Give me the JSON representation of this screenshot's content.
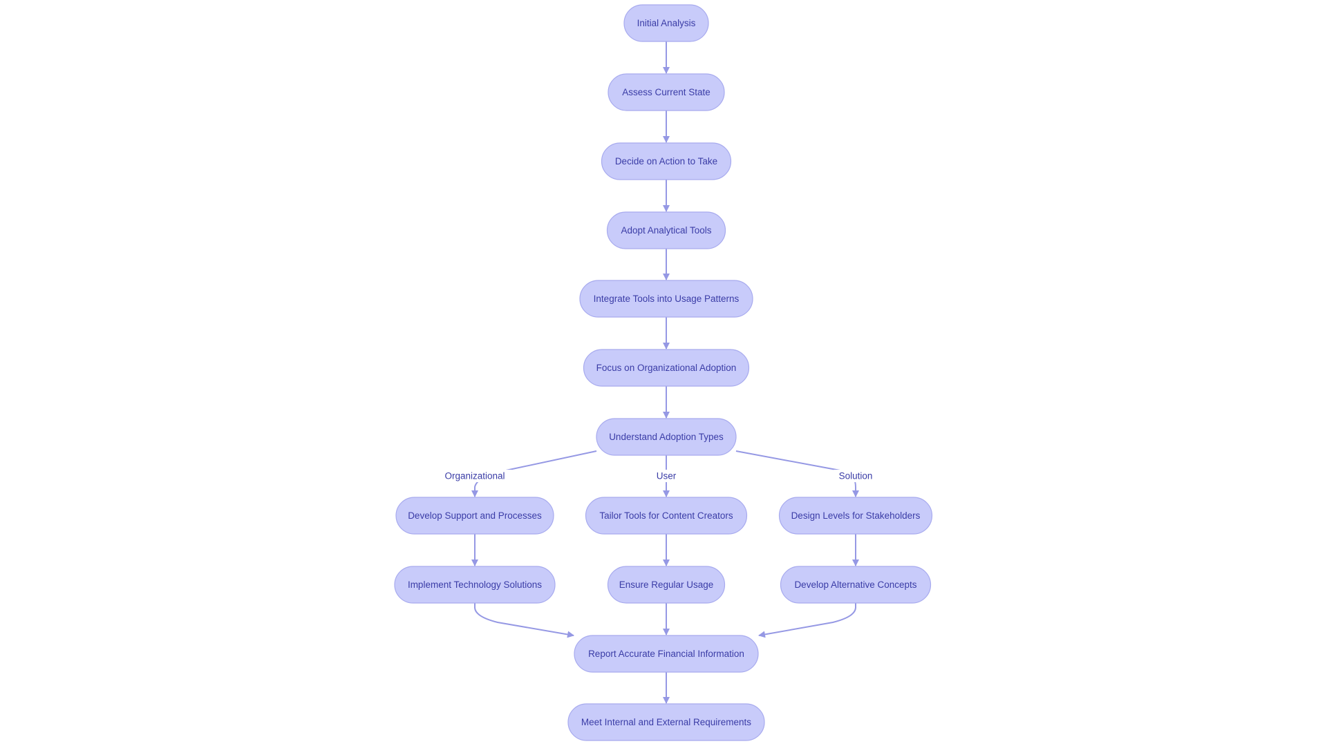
{
  "diagram": {
    "type": "flowchart",
    "direction": "top-down",
    "colors": {
      "node_fill": "#C8CBFA",
      "node_border": "#A7AAEE",
      "text": "#3A3CA6",
      "edge": "#9598E4",
      "background": "#FFFFFF"
    },
    "nodes": [
      {
        "id": "n1",
        "label": "Initial Analysis"
      },
      {
        "id": "n2",
        "label": "Assess Current State"
      },
      {
        "id": "n3",
        "label": "Decide on Action to Take"
      },
      {
        "id": "n4",
        "label": "Adopt Analytical Tools"
      },
      {
        "id": "n5",
        "label": "Integrate Tools into Usage Patterns"
      },
      {
        "id": "n6",
        "label": "Focus on Organizational Adoption"
      },
      {
        "id": "n7",
        "label": "Understand Adoption Types"
      },
      {
        "id": "n8",
        "label": "Develop Support and Processes"
      },
      {
        "id": "n9",
        "label": "Tailor Tools for Content Creators"
      },
      {
        "id": "n10",
        "label": "Design Levels for Stakeholders"
      },
      {
        "id": "n11",
        "label": "Implement Technology Solutions"
      },
      {
        "id": "n12",
        "label": "Ensure Regular Usage"
      },
      {
        "id": "n13",
        "label": "Develop Alternative Concepts"
      },
      {
        "id": "n14",
        "label": "Report Accurate Financial Information"
      },
      {
        "id": "n15",
        "label": "Meet Internal and External Requirements"
      }
    ],
    "edges": [
      {
        "from": "n1",
        "to": "n2",
        "label": ""
      },
      {
        "from": "n2",
        "to": "n3",
        "label": ""
      },
      {
        "from": "n3",
        "to": "n4",
        "label": ""
      },
      {
        "from": "n4",
        "to": "n5",
        "label": ""
      },
      {
        "from": "n5",
        "to": "n6",
        "label": ""
      },
      {
        "from": "n6",
        "to": "n7",
        "label": ""
      },
      {
        "from": "n7",
        "to": "n8",
        "label": "Organizational"
      },
      {
        "from": "n7",
        "to": "n9",
        "label": "User"
      },
      {
        "from": "n7",
        "to": "n10",
        "label": "Solution"
      },
      {
        "from": "n8",
        "to": "n11",
        "label": ""
      },
      {
        "from": "n9",
        "to": "n12",
        "label": ""
      },
      {
        "from": "n10",
        "to": "n13",
        "label": ""
      },
      {
        "from": "n11",
        "to": "n14",
        "label": ""
      },
      {
        "from": "n12",
        "to": "n14",
        "label": ""
      },
      {
        "from": "n13",
        "to": "n14",
        "label": ""
      },
      {
        "from": "n14",
        "to": "n15",
        "label": ""
      }
    ]
  }
}
